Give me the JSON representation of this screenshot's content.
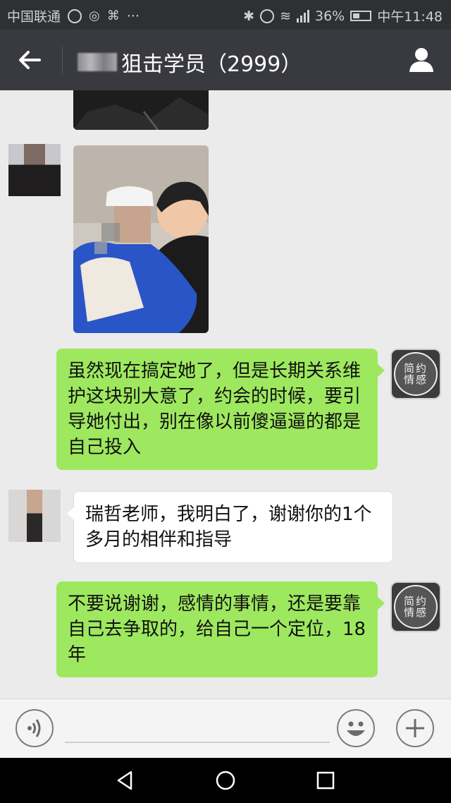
{
  "status_bar": {
    "carrier": "中国联通",
    "battery": "36%",
    "time": "中午11:48"
  },
  "header": {
    "title": "狙击学员（2999）",
    "back_icon": "back-arrow-icon",
    "profile_icon": "person-icon"
  },
  "messages": [
    {
      "side": "left",
      "type": "image",
      "description_icon": "photo-icon"
    },
    {
      "side": "left",
      "type": "image",
      "description_icon": "photo-icon"
    },
    {
      "side": "right",
      "type": "text",
      "text": "虽然现在搞定她了，但是长期关系维护这块别大意了，约会的时候，要引导她付出，别在像以前傻逼逼的都是自己投入"
    },
    {
      "side": "left",
      "type": "text",
      "text": "瑞哲老师，我明白了，谢谢你的1个多月的相伴和指导"
    },
    {
      "side": "right",
      "type": "text",
      "text": "不要说谢谢，感情的事情，还是要靠自己去争取的，给自己一个定位，18年"
    }
  ],
  "brand_avatar": {
    "line1": "简约",
    "line2": "情感"
  },
  "input_bar": {
    "voice_icon": "voice-icon",
    "emoji_icon": "emoji-icon",
    "plus_icon": "plus-icon"
  },
  "colors": {
    "sent_bubble": "#9ee85f",
    "received_bubble": "#ffffff",
    "header_bg": "#393a3f",
    "chat_bg": "#ebebeb"
  }
}
